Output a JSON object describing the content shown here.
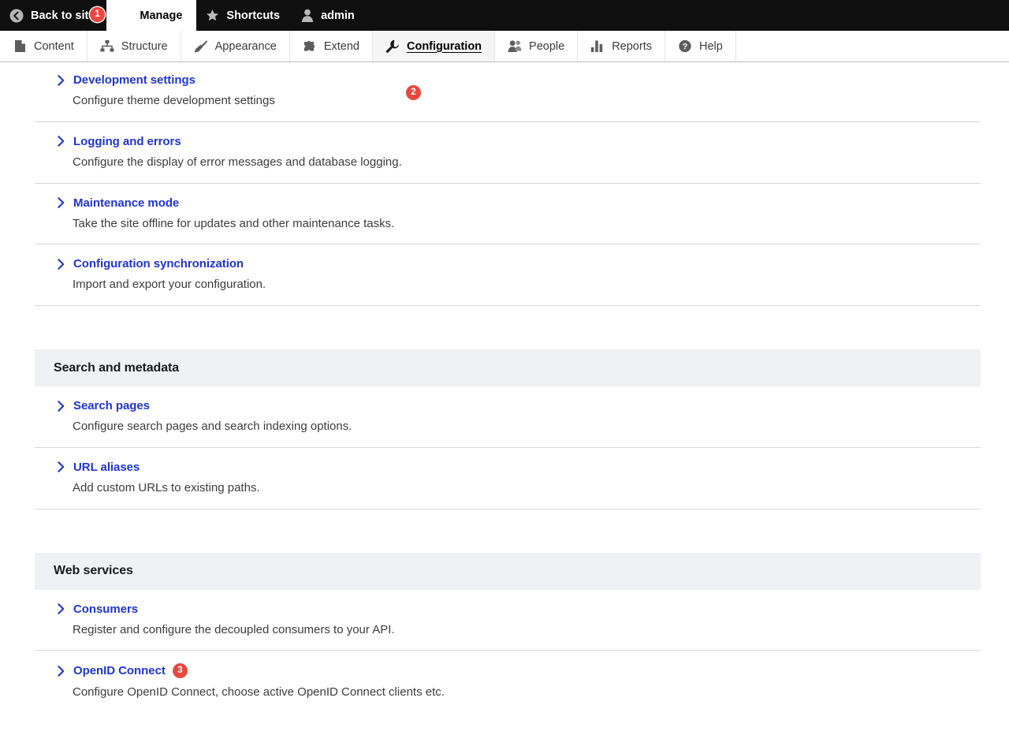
{
  "admin_toolbar": {
    "items": [
      {
        "label": "Back to site",
        "icon": "back-arrow-icon",
        "badge": "1"
      },
      {
        "label": "Manage",
        "icon": "hamburger-icon",
        "active": true
      },
      {
        "label": "Shortcuts",
        "icon": "star-icon"
      },
      {
        "label": "admin",
        "icon": "user-icon"
      }
    ]
  },
  "menu": {
    "tabs": [
      {
        "label": "Content",
        "icon": "document-icon",
        "active": false
      },
      {
        "label": "Structure",
        "icon": "sitemap-icon",
        "active": false
      },
      {
        "label": "Appearance",
        "icon": "paintbrush-icon",
        "active": false
      },
      {
        "label": "Extend",
        "icon": "puzzle-icon",
        "active": false
      },
      {
        "label": "Configuration",
        "icon": "wrench-icon",
        "active": true,
        "badge": "2"
      },
      {
        "label": "People",
        "icon": "people-icon",
        "active": false
      },
      {
        "label": "Reports",
        "icon": "bar-chart-icon",
        "active": false
      },
      {
        "label": "Help",
        "icon": "question-mark-icon",
        "active": false
      }
    ]
  },
  "content": {
    "top_items": [
      {
        "title": "Development settings",
        "description": "Configure theme development settings"
      },
      {
        "title": "Logging and errors",
        "description": "Configure the display of error messages and database logging."
      },
      {
        "title": "Maintenance mode",
        "description": "Take the site offline for updates and other maintenance tasks."
      },
      {
        "title": "Configuration synchronization",
        "description": "Import and export your configuration."
      }
    ],
    "sections": [
      {
        "heading": "Search and metadata",
        "items": [
          {
            "title": "Search pages",
            "description": "Configure search pages and search indexing options."
          },
          {
            "title": "URL aliases",
            "description": "Add custom URLs to existing paths."
          }
        ]
      },
      {
        "heading": "Web services",
        "items": [
          {
            "title": "Consumers",
            "description": "Register and configure the decoupled consumers to your API."
          },
          {
            "title": "OpenID Connect",
            "badge": "3",
            "description": "Configure OpenID Connect, choose active OpenID Connect clients etc."
          }
        ]
      }
    ]
  },
  "colors": {
    "link_blue": "#1f35d1",
    "badge_red": "#e8483f",
    "section_band": "#f0f1f5",
    "toolbar_black": "#0f0f0f"
  }
}
